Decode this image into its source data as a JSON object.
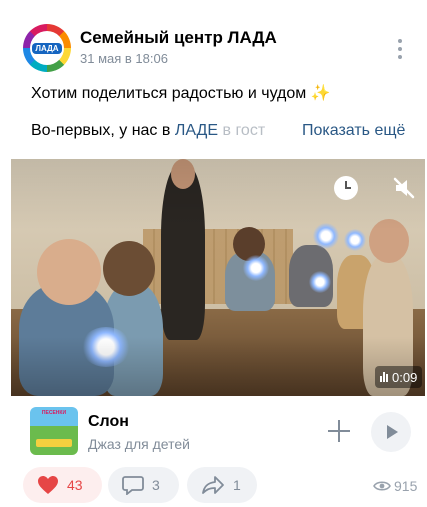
{
  "post": {
    "author": "Семейный центр ЛАДА",
    "date": "31 мая в 18:06",
    "avatar_logo_text": "ЛАДА",
    "text_line1": "Хотим поделиться радостью и чудом",
    "text_line1_emoji": "✨",
    "text_line2_start": "Во-первых, у нас в ",
    "text_line2_link": "ЛАДЕ",
    "text_line2_end": " в гост",
    "show_more": "Показать ещё"
  },
  "video": {
    "duration": "0:09",
    "icons": [
      "clock-icon",
      "mute-icon",
      "equalizer-icon"
    ]
  },
  "audio": {
    "title": "Слон",
    "artist": "Джаз для детей",
    "cover_text": "ПЕСЕНКИ",
    "icons": [
      "add-icon",
      "play-icon"
    ]
  },
  "actions": {
    "likes": "43",
    "comments": "3",
    "shares": "1",
    "views": "915",
    "colors": {
      "like": "#e64646",
      "muted": "#818c99",
      "link": "#2a5885"
    }
  }
}
